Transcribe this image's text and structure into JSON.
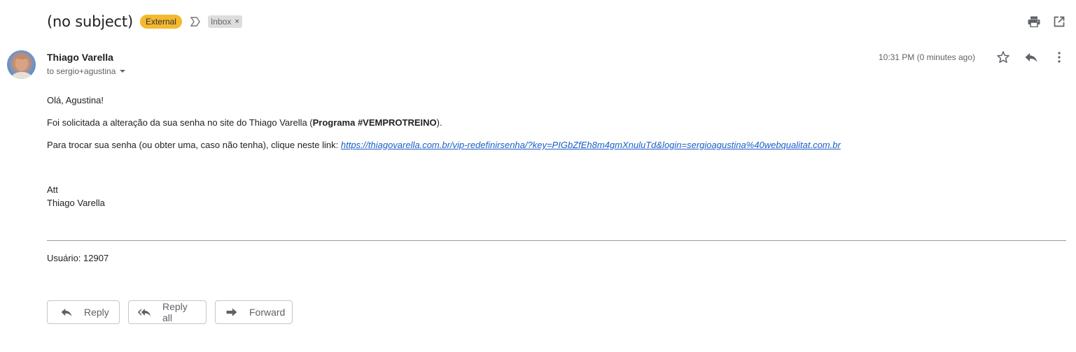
{
  "subject": "(no subject)",
  "labels": {
    "external": "External",
    "inbox": "Inbox",
    "inbox_remove": "×"
  },
  "icons": {
    "importance": "importance-marker-icon",
    "print": "printer-icon",
    "open_new_window": "open-in-new-window-icon",
    "star": "star-icon",
    "reply": "reply-icon",
    "more": "more-vert-icon",
    "reply_all": "reply-all-icon",
    "forward": "forward-icon"
  },
  "colors": {
    "external_badge": "#f5b82e",
    "inbox_label": "#dddddd",
    "link": "#1a5ec7",
    "divider": "#9a9a9a"
  },
  "sender": {
    "name": "Thiago Varella",
    "recipient": "to sergio+agustina",
    "time": "10:31 PM (0 minutes ago)"
  },
  "body": {
    "greeting": "Olá, Agustina!",
    "line1_prefix": "Foi solicitada a alteração da sua senha no site do Thiago Varella (",
    "line1_bold": "Programa #VEMPROTREINO",
    "line1_suffix": ").",
    "line2_prefix": "Para trocar sua senha (ou obter uma, caso não tenha), clique neste link: ",
    "link": "https://thiagovarella.com.br/vip-redefinirsenha/?key=PIGbZfEh8m4gmXnuluTd&login=sergioagustina%40webqualitat.com.br",
    "att": "Att",
    "signature": "Thiago Varella",
    "user_line": "Usuário: 12907"
  },
  "actions": {
    "reply": "Reply",
    "reply_all": "Reply all",
    "forward": "Forward"
  }
}
